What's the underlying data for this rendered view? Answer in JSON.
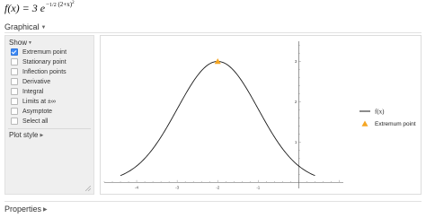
{
  "formula": {
    "lhs": "f(x) = 3",
    "e": "e",
    "exponent_sign": "−",
    "frac_num": "1",
    "frac_den": "2",
    "exponent_rest": "(2+x)",
    "exponent_power": "2"
  },
  "graphical": {
    "label": "Graphical"
  },
  "panel": {
    "show_label": "Show",
    "options": [
      {
        "label": "Extremum point",
        "checked": true
      },
      {
        "label": "Stationary point",
        "checked": false
      },
      {
        "label": "Inflection points",
        "checked": false
      },
      {
        "label": "Derivative",
        "checked": false
      },
      {
        "label": "Integral",
        "checked": false
      },
      {
        "label": "Limits at ±∞",
        "checked": false
      },
      {
        "label": "Asymptote",
        "checked": false
      },
      {
        "label": "Select all",
        "checked": false
      }
    ],
    "plot_style_label": "Plot style"
  },
  "properties": {
    "label": "Properties"
  },
  "colors": {
    "curve": "#1a1a1a",
    "marker": "#f5a623",
    "checkbox": "#3d8af7"
  },
  "chart_data": {
    "type": "line",
    "function": "3*exp(-0.5*(2+x)^2)",
    "xlim": [
      -4.8,
      1.1
    ],
    "ylim": [
      -0.15,
      3.5
    ],
    "x_ticks": [
      "-4",
      "-3",
      "-2",
      "-1"
    ],
    "y_ticks": [
      "1",
      "2",
      "3"
    ],
    "x_tick_values": [
      -4,
      -3,
      -2,
      -1
    ],
    "y_tick_values": [
      1,
      2,
      3
    ],
    "curve_x_range": [
      -4.4,
      0.4
    ],
    "extremum": {
      "x": -2,
      "y": 3
    },
    "legend": [
      {
        "label": "f(x)",
        "marker": "line"
      },
      {
        "label": "Extremum point",
        "marker": "triangle"
      }
    ],
    "legend_position": "right"
  }
}
